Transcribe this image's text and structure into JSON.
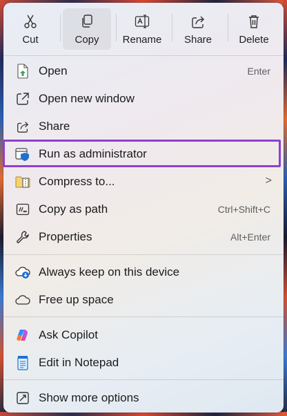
{
  "toolbar": {
    "cut": "Cut",
    "copy": "Copy",
    "rename": "Rename",
    "share": "Share",
    "delete": "Delete"
  },
  "items": {
    "open": {
      "label": "Open",
      "shortcut": "Enter"
    },
    "open_new_window": {
      "label": "Open new window"
    },
    "share": {
      "label": "Share"
    },
    "run_as_admin": {
      "label": "Run as administrator"
    },
    "compress": {
      "label": "Compress to...",
      "arrow": ">"
    },
    "copy_as_path": {
      "label": "Copy as path",
      "shortcut": "Ctrl+Shift+C"
    },
    "properties": {
      "label": "Properties",
      "shortcut": "Alt+Enter"
    },
    "always_keep": {
      "label": "Always keep on this device"
    },
    "free_up_space": {
      "label": "Free up space"
    },
    "ask_copilot": {
      "label": "Ask Copilot"
    },
    "edit_notepad": {
      "label": "Edit in Notepad"
    },
    "show_more": {
      "label": "Show more options"
    }
  },
  "colors": {
    "highlight_border": "#8d3fd0",
    "accent_blue": "#1f6fd1",
    "open_green": "#3aa35a"
  }
}
